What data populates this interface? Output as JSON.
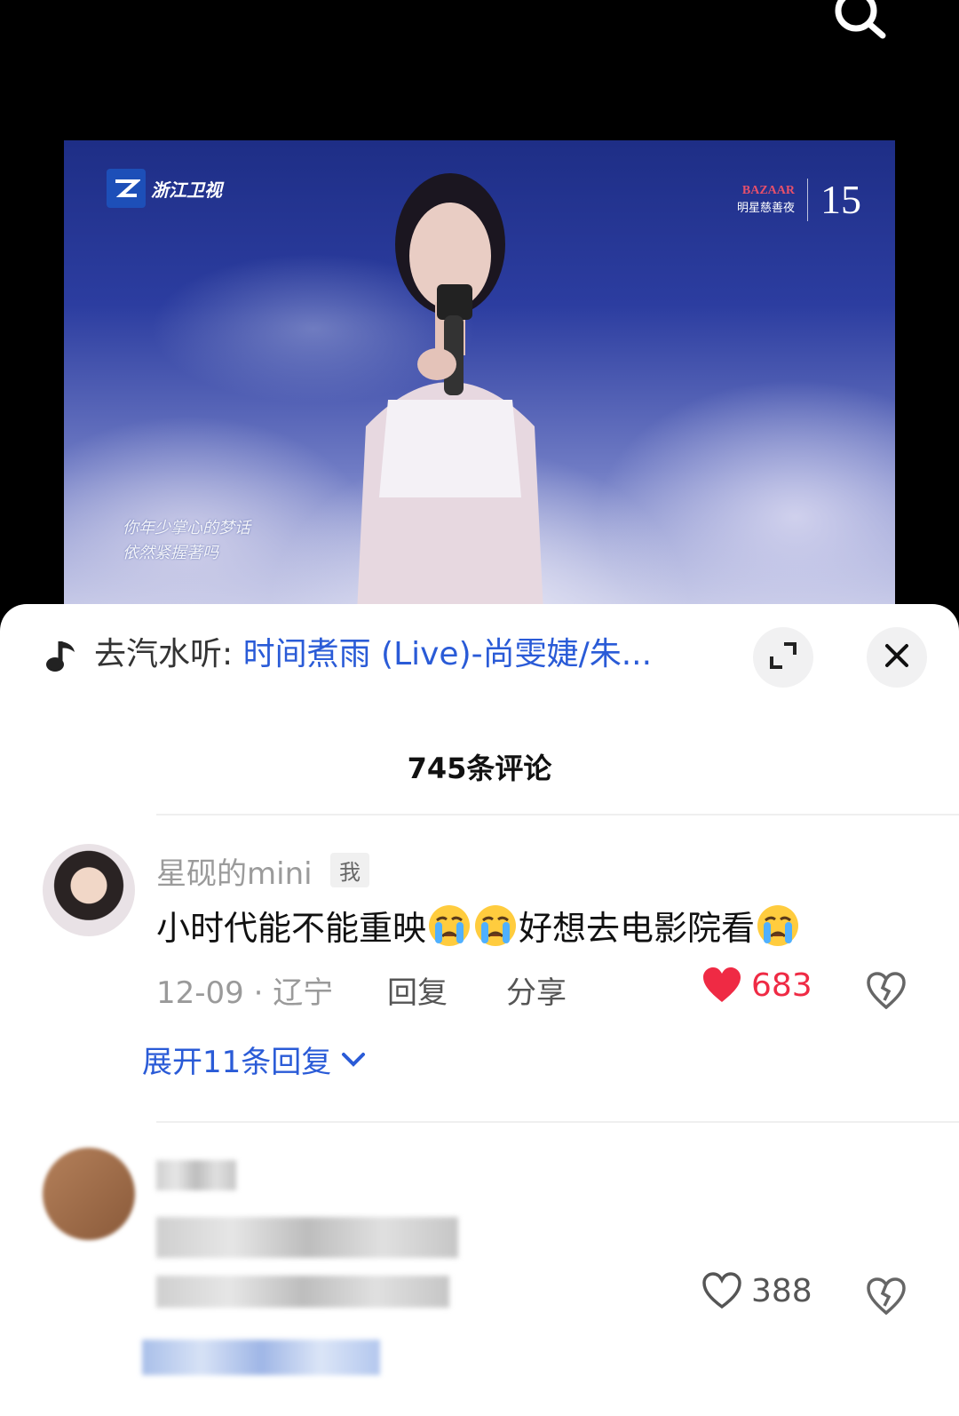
{
  "music": {
    "prefix": "去汽水听: ",
    "song": "时间煮雨 (Live)-尚雯婕/朱..."
  },
  "video": {
    "channel": "浙江卫视",
    "event_badge": "BAZAAR",
    "event_sub": "明星慈善夜",
    "event_number": "15",
    "subtitle_line1": "你年少掌心的梦话",
    "subtitle_line2": "依然紧握著吗"
  },
  "comments": {
    "count_label": "745条评论",
    "items": [
      {
        "username": "星砚的mini",
        "badge": "我",
        "text_parts": [
          "小时代能不能重映",
          "好想去电影院看"
        ],
        "emoji": "crying-face-emoji",
        "date_location": "12-09 · 辽宁",
        "reply_label": "回复",
        "share_label": "分享",
        "likes": "683",
        "liked": true,
        "expand_label": "展开11条回复"
      },
      {
        "likes": "388",
        "liked": false
      }
    ]
  },
  "colors": {
    "accent_blue": "#2a5bd7",
    "like_red": "#ef2a44"
  }
}
